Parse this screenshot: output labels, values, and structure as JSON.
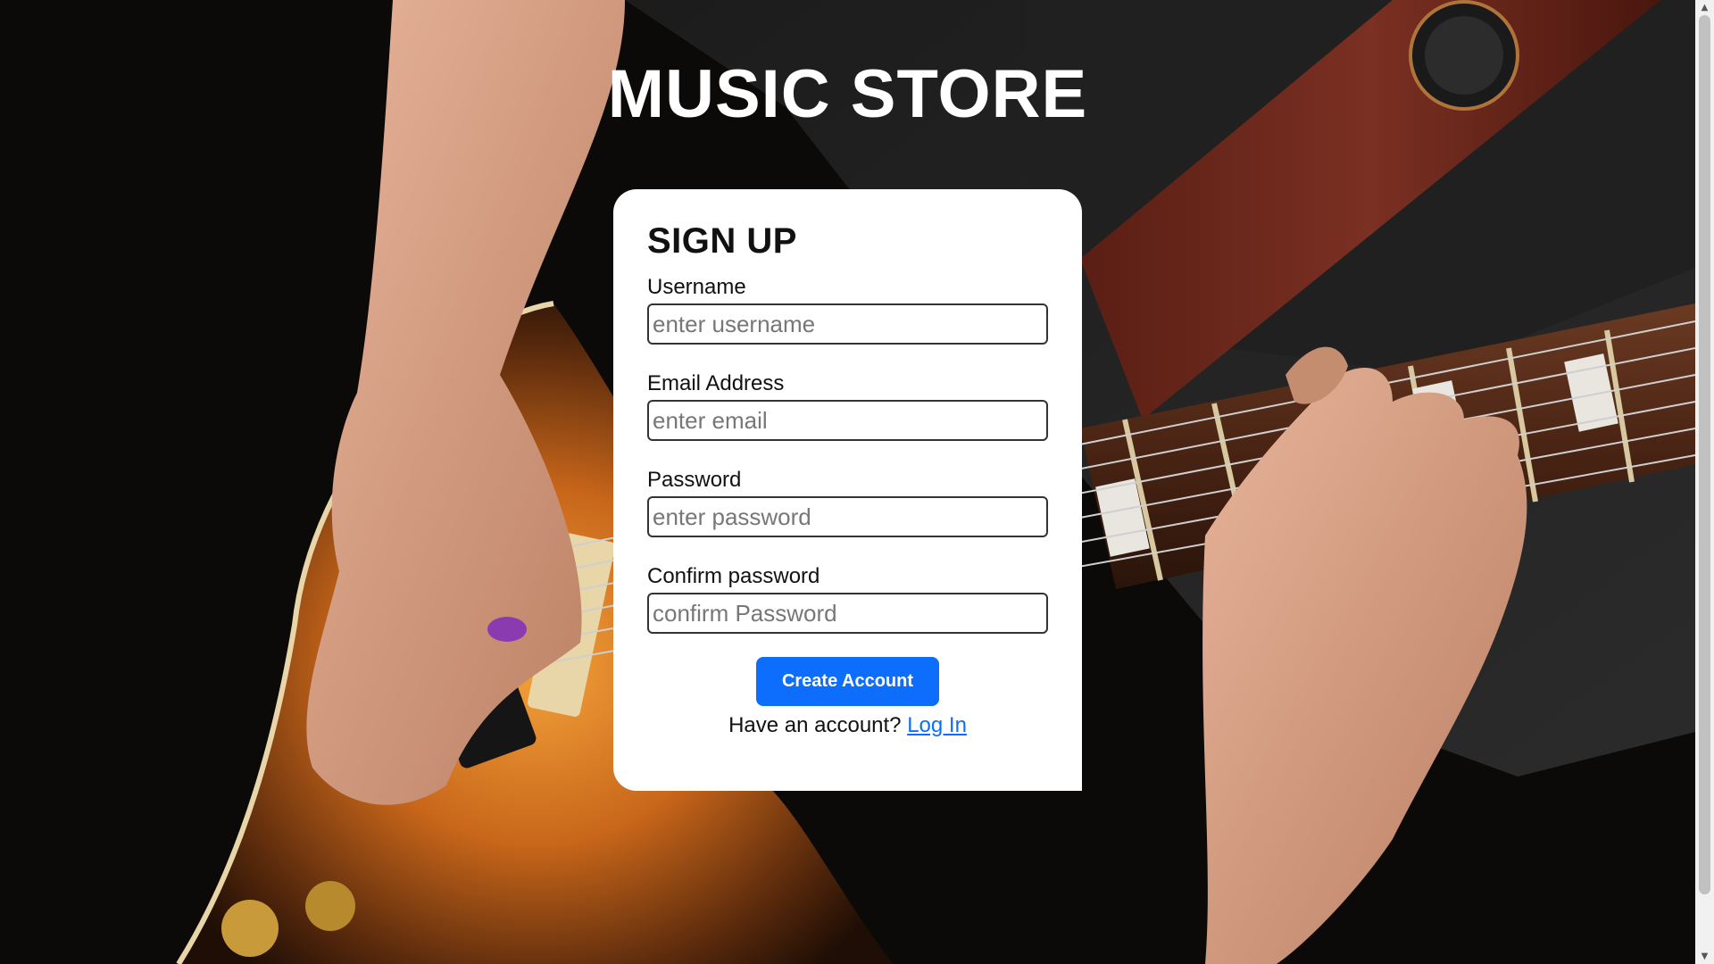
{
  "site": {
    "title": "MUSIC STORE"
  },
  "signup": {
    "heading": "SIGN UP",
    "fields": [
      {
        "label": "Username",
        "placeholder": "enter username",
        "value": ""
      },
      {
        "label": "Email Address",
        "placeholder": "enter email",
        "value": ""
      },
      {
        "label": "Password",
        "placeholder": "enter password",
        "value": ""
      },
      {
        "label": "Confirm password",
        "placeholder": "confirm Password",
        "value": ""
      }
    ],
    "submit_label": "Create Account",
    "login_prompt": "Have an account?",
    "login_link": "Log In"
  },
  "colors": {
    "accent": "#0d6efd",
    "background": "#0b0a09",
    "card": "#ffffff"
  },
  "icons": {
    "scroll_up": "scroll-up-arrow-icon",
    "scroll_down": "scroll-down-arrow-icon"
  }
}
